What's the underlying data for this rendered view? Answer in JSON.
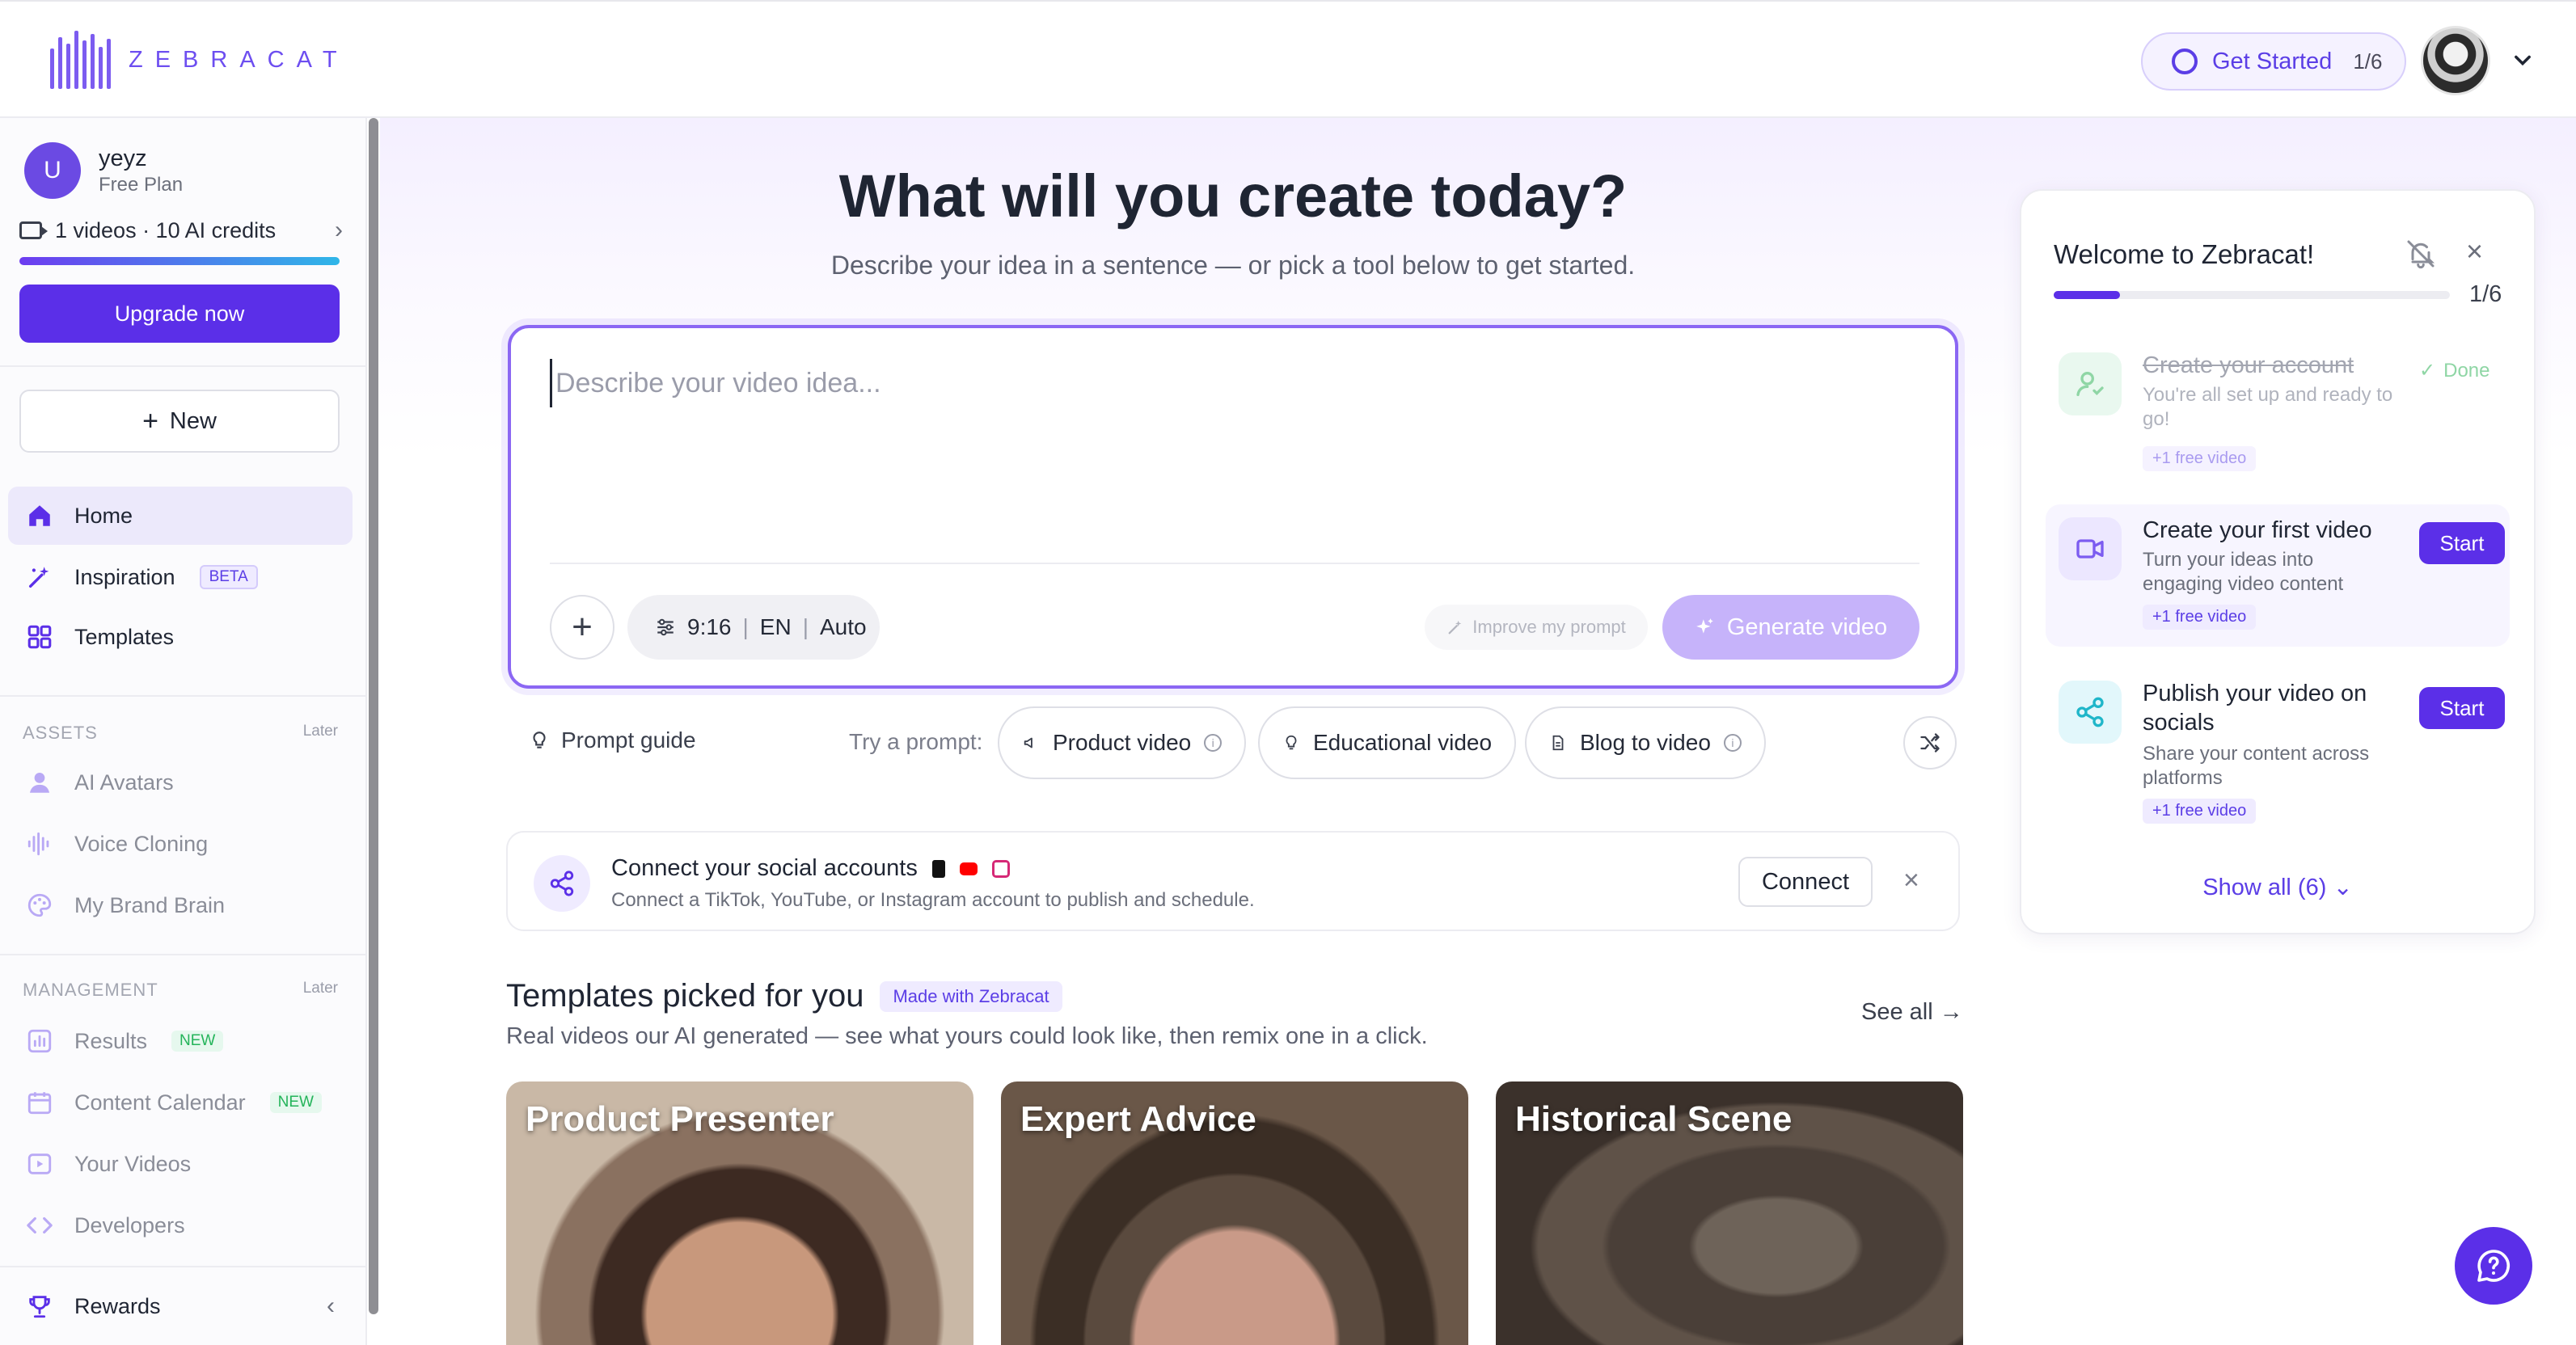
{
  "brand": {
    "logo_text": "ZEBRACAT",
    "accent": "#5b2fe8"
  },
  "header": {
    "get_started_label": "Get Started",
    "get_started_progress": "1/6"
  },
  "user": {
    "initial": "U",
    "name": "yeyz",
    "plan": "Free Plan",
    "credits": "1 videos · 10 AI credits",
    "upgrade_label": "Upgrade now"
  },
  "sidebar": {
    "new_label": "New",
    "nav": [
      {
        "label": "Home",
        "icon": "home-icon",
        "active": true
      },
      {
        "label": "Inspiration",
        "icon": "sparkle-wand-icon",
        "badge": "BETA"
      },
      {
        "label": "Templates",
        "icon": "grid-icon"
      }
    ],
    "assets": {
      "heading": "ASSETS",
      "later": "Later",
      "items": [
        {
          "label": "AI Avatars",
          "icon": "person-icon"
        },
        {
          "label": "Voice Cloning",
          "icon": "waveform-icon"
        },
        {
          "label": "My Brand Brain",
          "icon": "palette-icon"
        }
      ]
    },
    "management": {
      "heading": "MANAGEMENT",
      "later": "Later",
      "items": [
        {
          "label": "Results",
          "icon": "chart-icon",
          "badge": "NEW"
        },
        {
          "label": "Content Calendar",
          "icon": "calendar-icon",
          "badge": "NEW"
        },
        {
          "label": "Your Videos",
          "icon": "video-icon"
        },
        {
          "label": "Developers",
          "icon": "code-icon"
        }
      ]
    },
    "rewards_label": "Rewards"
  },
  "main": {
    "headline": "What will you create today?",
    "subhead": "Describe your idea in a sentence — or pick a tool below to get started.",
    "prompt_placeholder": "Describe your video idea...",
    "settings": {
      "ratio": "9:16",
      "lang": "EN",
      "mode": "Auto",
      "divider": "|"
    },
    "improve_label": "Improve my prompt",
    "generate_label": "Generate video",
    "prompt_guide_label": "Prompt guide",
    "try_label": "Try a prompt:",
    "chips": [
      {
        "label": "Product video",
        "icon": "megaphone-icon"
      },
      {
        "label": "Educational video",
        "icon": "lightbulb-icon"
      },
      {
        "label": "Blog to video",
        "icon": "document-icon"
      }
    ],
    "connect": {
      "title": "Connect your social accounts",
      "subtitle": "Connect a TikTok, YouTube, or Instagram account to publish and schedule.",
      "button": "Connect",
      "colors": {
        "tiktok": "#111111",
        "youtube": "#ff0000",
        "instagram": "#d62976"
      }
    },
    "templates": {
      "title": "Templates picked for you",
      "badge": "Made with Zebracat",
      "subtitle": "Real videos our AI generated — see what yours could look like, then remix one in a click.",
      "see_all": "See all",
      "cards": [
        {
          "label": "Product Presenter"
        },
        {
          "label": "Expert Advice"
        },
        {
          "label": "Historical Scene"
        }
      ]
    }
  },
  "welcome": {
    "title": "Welcome to Zebracat!",
    "step": "1/6",
    "progress": 0.167,
    "tasks": [
      {
        "title": "Create your account",
        "desc": "You're all set up and ready to go!",
        "badge": "+1 free video",
        "status": "Done"
      },
      {
        "title": "Create your first video",
        "desc": "Turn your ideas into engaging video content",
        "badge": "+1 free video",
        "action": "Start"
      },
      {
        "title": "Publish your video on socials",
        "desc": "Share your content across platforms",
        "badge": "+1 free video",
        "action": "Start"
      }
    ],
    "show_all": "Show all (6)"
  }
}
